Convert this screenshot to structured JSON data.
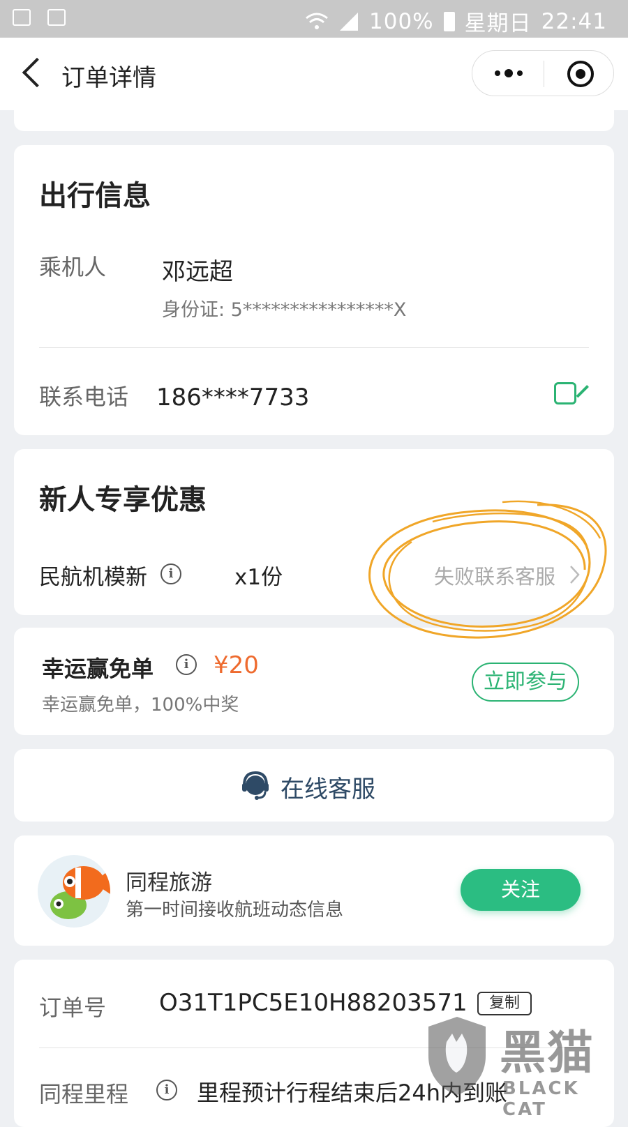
{
  "status_bar": {
    "battery": "100%",
    "day": "星期日",
    "time": "22:41"
  },
  "nav": {
    "title": "订单详情"
  },
  "travel": {
    "title": "出行信息",
    "passenger_label": "乘机人",
    "passenger_name": "邓远超",
    "id_text": "身份证: 5****************X",
    "phone_label": "联系电话",
    "phone_value": "186****7733"
  },
  "promo": {
    "title": "新人专享优惠",
    "item_name": "民航机模新",
    "quantity": "x1份",
    "status": "失败联系客服"
  },
  "lucky": {
    "title": "幸运赢免单",
    "price": "¥20",
    "desc": "幸运赢免单，100%中奖",
    "button": "立即参与"
  },
  "service": {
    "label": "在线客服"
  },
  "follow": {
    "name": "同程旅游",
    "desc": "第一时间接收航班动态信息",
    "button": "关注"
  },
  "order": {
    "number_label": "订单号",
    "number_value": "O31T1PC5E10H88203571",
    "copy_label": "复制",
    "mileage_label": "同程里程",
    "mileage_value": "里程预计行程结束后24h内到账"
  },
  "watermark": {
    "cn": "黑猫",
    "en": "BLACK CAT"
  },
  "colors": {
    "green": "#2bb373",
    "orange": "#ee6a2e",
    "annotation": "#f0a628"
  }
}
